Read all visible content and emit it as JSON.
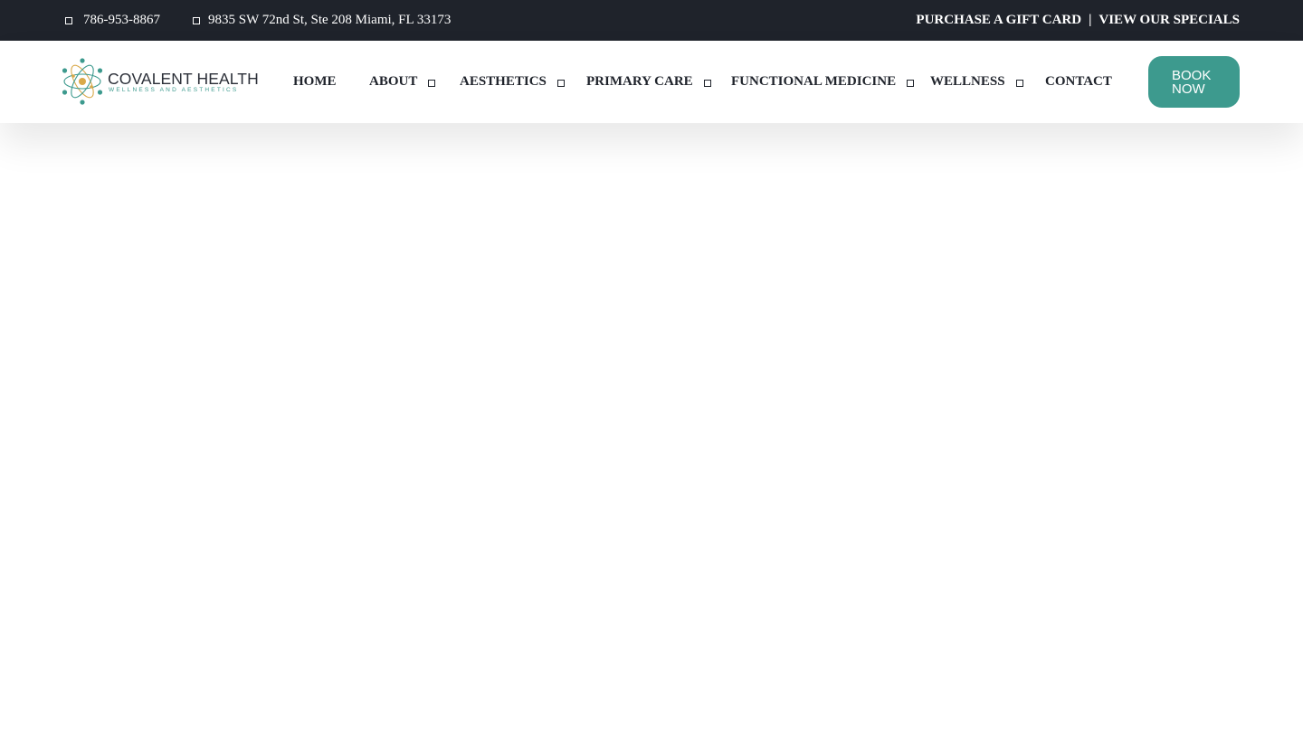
{
  "topbar": {
    "phone": "786-953-8867",
    "phone_icon": "square-icon",
    "address": "9835 SW 72nd St, Ste 208 Miami, FL 33173",
    "address_icon": "square-icon",
    "gift_card": "PURCHASE A GIFT CARD",
    "separator": "|",
    "specials": "VIEW OUR SPECIALS"
  },
  "header": {
    "logo": {
      "title": "COVALENT HEALTH",
      "subtitle": "WELLNESS AND AESTHETICS"
    },
    "nav": [
      {
        "label": "HOME",
        "has_dropdown": false
      },
      {
        "label": "ABOUT",
        "has_dropdown": true
      },
      {
        "label": "AESTHETICS",
        "has_dropdown": true
      },
      {
        "label": "PRIMARY CARE",
        "has_dropdown": true
      },
      {
        "label": "FUNCTIONAL MEDICINE",
        "has_dropdown": true
      },
      {
        "label": "WELLNESS",
        "has_dropdown": true
      },
      {
        "label": "CONTACT",
        "has_dropdown": false
      }
    ],
    "book_button": "BOOK NOW"
  },
  "colors": {
    "topbar_bg": "#1f232b",
    "accent": "#3d9a8e",
    "text_dark": "#1f232b"
  }
}
